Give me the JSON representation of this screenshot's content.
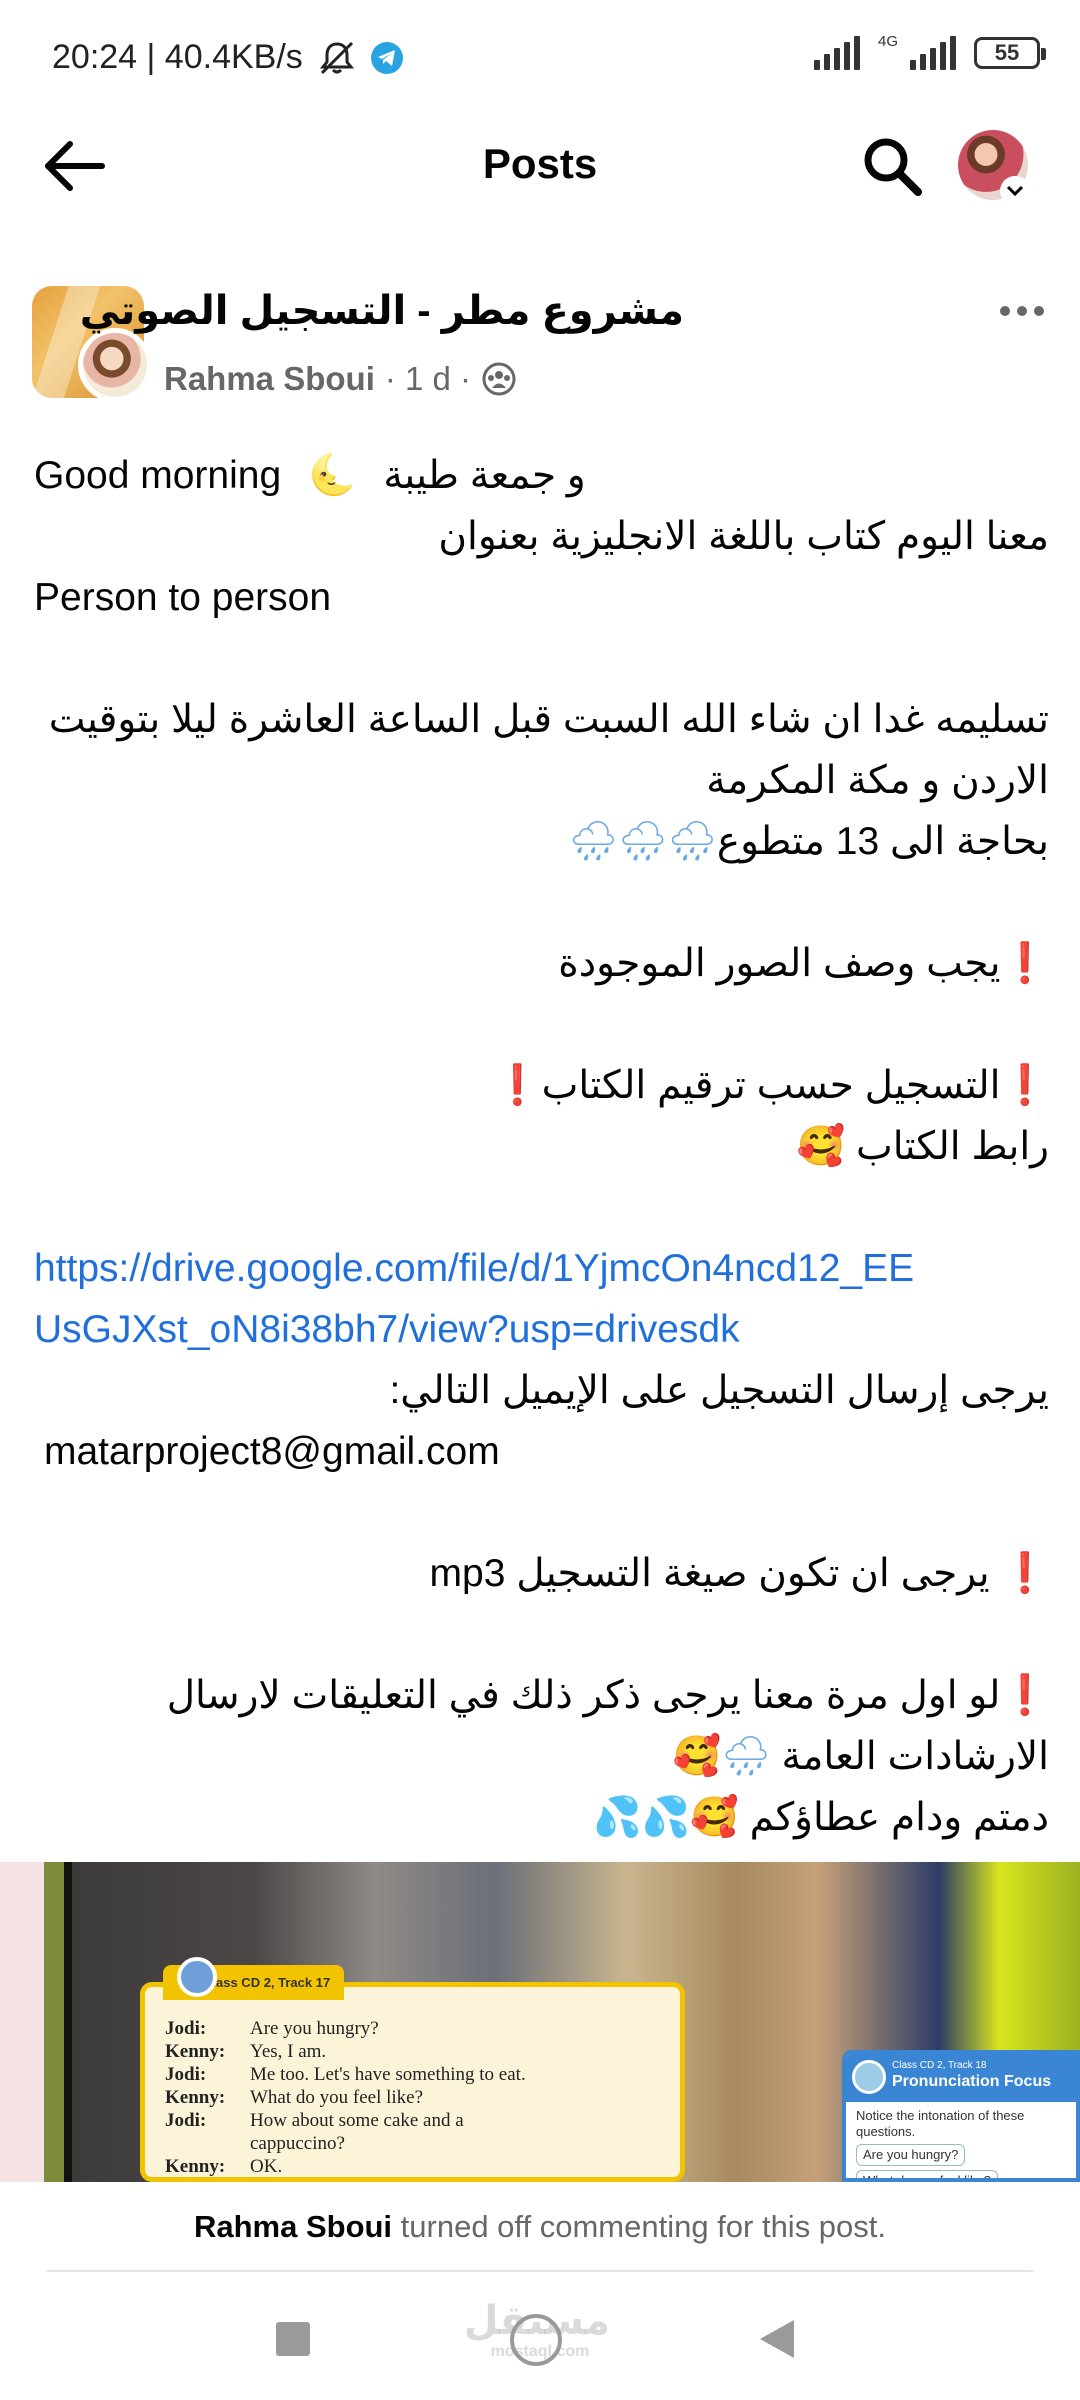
{
  "status_bar": {
    "time_speed": "20:24 | 40.4KB/s",
    "network_type": "4G",
    "battery": "55",
    "icons": [
      "mute-icon",
      "telegram-icon",
      "signal-icon",
      "battery-icon"
    ]
  },
  "header": {
    "title": "Posts",
    "icons": [
      "back-arrow-icon",
      "search-icon",
      "profile-avatar"
    ]
  },
  "post": {
    "group_name": "مشروع مطر - التسجيل الصوتي",
    "author": "Rahma Sboui",
    "time": "· 1 d ·",
    "privacy_icon": "group-members-icon",
    "body": {
      "l1_en": "Good morning",
      "l1_moon": "🌜",
      "l1_ar": "و جمعة طيبة",
      "l2": "معنا اليوم كتاب باللغة الانجليزية بعنوان",
      "l3": "Person to person",
      "l5": "تسليمه غدا ان شاء الله السبت قبل الساعة العاشرة ليلا بتوقيت",
      "l6": "الاردن و مكة المكرمة",
      "l7_text": "بحاجة الى 13 متطوع",
      "l7_emoji": "🌧🌧🌧",
      "l9_excl": "❗",
      "l9": "يجب وصف الصور الموجودة",
      "l11_excl1": "❗",
      "l11": "التسجيل حسب ترقيم الكتاب",
      "l11_excl2": "❗",
      "l12": "رابط الكتاب",
      "l12_emoji": "🥰",
      "link_line1": "https://drive.google.com/file/d/1YjmcOn4ncd12_EE",
      "link_line2": "UsGJXst_oN8i38bh7/view?usp=drivesdk",
      "l16": "يرجى إرسال التسجيل على الإيميل التالي:",
      "email": "matarproject8@gmail.com",
      "l19_excl": "❗",
      "l19": "يرجى ان تكون صيغة التسجيل mp3",
      "l21_excl": "❗",
      "l21": "لو اول مرة معنا يرجى ذكر ذلك في التعليقات لارسال",
      "l22": "الارشادات العامة",
      "l22_emoji": "🌧🥰",
      "l23": "دمتم ودام عطاؤكم",
      "l23_emoji": "🥰💦💦"
    },
    "image": {
      "card_tab": "Class CD 2, Track 17",
      "dialogue": [
        {
          "speaker": "Jodi:",
          "line": "Are you hungry?"
        },
        {
          "speaker": "Kenny:",
          "line": "Yes, I am."
        },
        {
          "speaker": "Jodi:",
          "line": "Me too. Let's have something to eat."
        },
        {
          "speaker": "Kenny:",
          "line": "What do you feel like?"
        },
        {
          "speaker": "Jodi:",
          "line": "How about some cake and a"
        },
        {
          "speaker": "",
          "line": "cappuccino?"
        },
        {
          "speaker": "Kenny:",
          "line": "OK."
        }
      ],
      "card2_small": "Class CD 2, Track 18",
      "card2_title": "Pronunciation Focus",
      "card2_body": "Notice the intonation of these questions.",
      "card2_pill1": "Are you hungry?",
      "card2_pill2": "What do you feel like?"
    }
  },
  "footer": {
    "notice_author": "Rahma Sboui",
    "notice_text": " turned off commenting for this post."
  },
  "watermark": {
    "ar": "مستقل",
    "en": "mostaql.com"
  }
}
